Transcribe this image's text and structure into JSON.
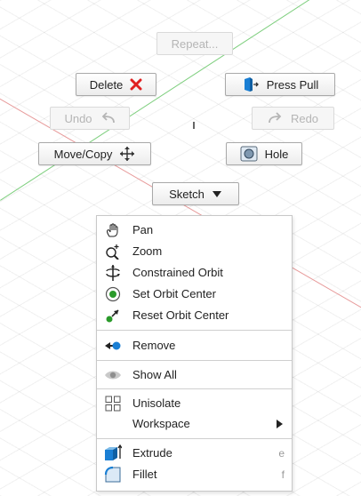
{
  "marking_menu": {
    "repeat": "Repeat...",
    "delete": "Delete",
    "press_pull": "Press Pull",
    "undo": "Undo",
    "redo": "Redo",
    "move_copy": "Move/Copy",
    "hole": "Hole",
    "sketch": "Sketch"
  },
  "context_menu": {
    "items": [
      {
        "label": "Pan",
        "icon": "hand-icon"
      },
      {
        "label": "Zoom",
        "icon": "zoom-icon"
      },
      {
        "label": "Constrained Orbit",
        "icon": "constrained-orbit-icon"
      },
      {
        "label": "Set Orbit Center",
        "icon": "orbit-center-icon"
      },
      {
        "label": "Reset Orbit Center",
        "icon": "reset-orbit-center-icon"
      },
      {
        "label": "Remove",
        "icon": "remove-icon"
      },
      {
        "label": "Show All",
        "icon": "eye-icon"
      },
      {
        "label": "Unisolate",
        "icon": "unisolate-icon"
      },
      {
        "label": "Workspace",
        "icon": ""
      },
      {
        "label": "Extrude",
        "icon": "extrude-icon",
        "shortcut": "e"
      },
      {
        "label": "Fillet",
        "icon": "fillet-icon",
        "shortcut": "f"
      }
    ]
  },
  "colors": {
    "delete_x": "#e02020",
    "accent_blue": "#1a7fd4",
    "orbit_green": "#2a9a2a",
    "axis_red": "#e79a9a",
    "axis_green": "#7fcf7f"
  }
}
